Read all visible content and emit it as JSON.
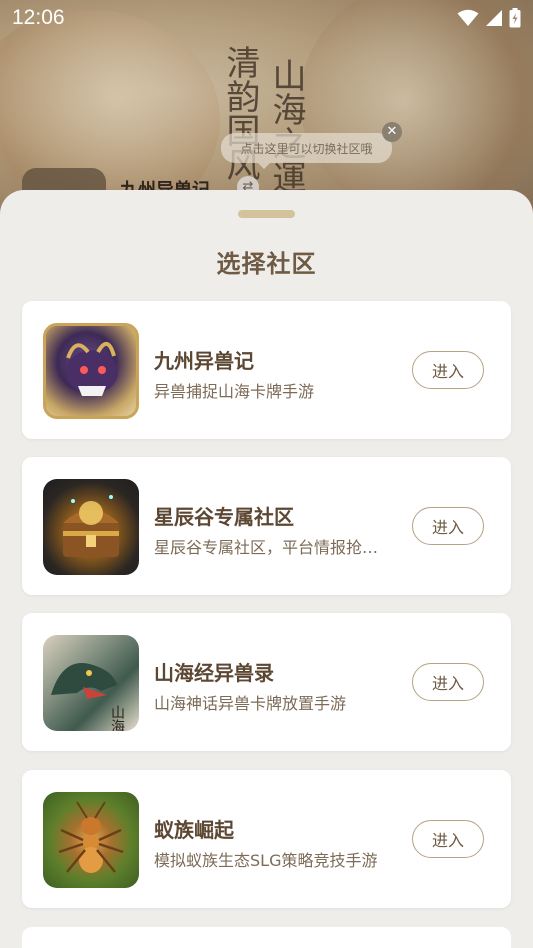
{
  "status_bar": {
    "time": "12:06"
  },
  "background": {
    "community_name": "九州异兽记",
    "calligraphy_line1": "清韵国风",
    "calligraphy_line2": "山海之運"
  },
  "tooltip": {
    "text": "点击这里可以切换社区哦"
  },
  "sheet": {
    "title": "选择社区",
    "communities": [
      {
        "name": "九州异兽记",
        "desc": "异兽捕捉山海卡牌手游",
        "enter_label": "进入",
        "icon": "beast-game-icon"
      },
      {
        "name": "星辰谷专属社区",
        "desc": "星辰谷专属社区，平台情报抢先知道",
        "enter_label": "进入",
        "icon": "treasure-chest-icon"
      },
      {
        "name": "山海经异兽录",
        "desc": "山海神话异兽卡牌放置手游",
        "enter_label": "进入",
        "icon": "dragon-icon"
      },
      {
        "name": "蚁族崛起",
        "desc": "模拟蚁族生态SLG策略竞技手游",
        "enter_label": "进入",
        "icon": "ant-icon"
      }
    ]
  },
  "colors": {
    "accent_brown": "#6f5a43",
    "handle": "#d3c39a",
    "sheet_bg": "#efedea"
  }
}
